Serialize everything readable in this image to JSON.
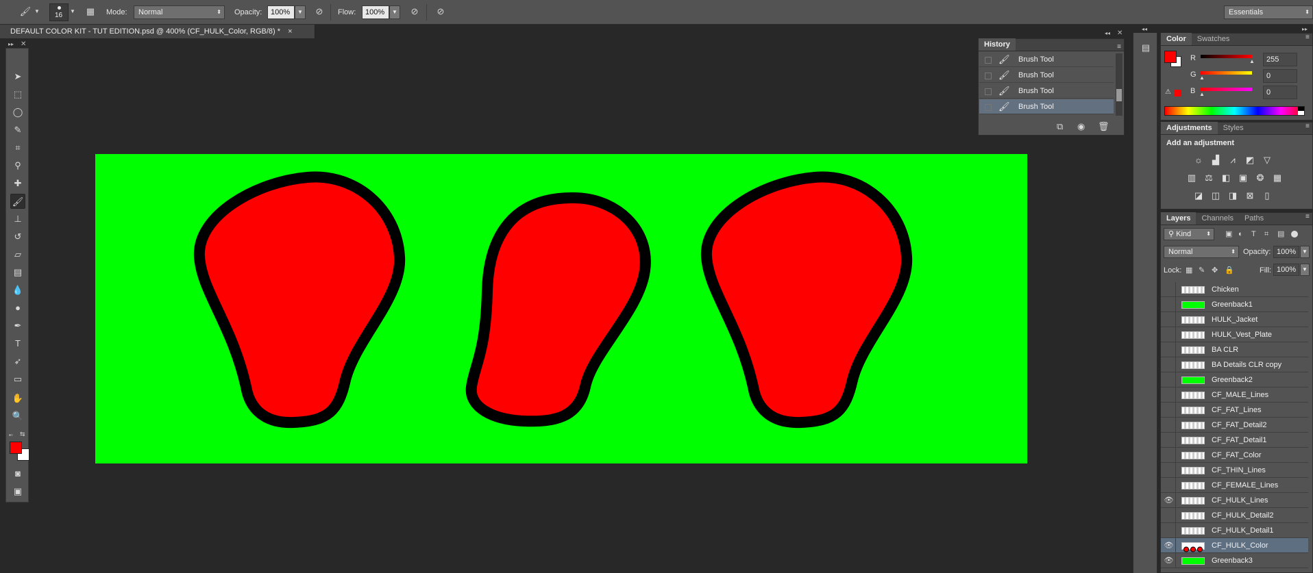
{
  "options_bar": {
    "brush_size": "16",
    "mode_label": "Mode:",
    "mode_value": "Normal",
    "opacity_label": "Opacity:",
    "opacity_value": "100%",
    "flow_label": "Flow:",
    "flow_value": "100%",
    "workspace": "Essentials"
  },
  "document": {
    "tab_title": "DEFAULT COLOR KIT - TUT EDITION.psd @ 400% (CF_HULK_Color, RGB/8) *",
    "close": "×",
    "canvas_bg": "#00ff00",
    "fill_color": "#ff0000",
    "stroke_color": "#000000"
  },
  "history": {
    "tab": "History",
    "items": [
      "Brush Tool",
      "Brush Tool",
      "Brush Tool",
      "Brush Tool"
    ],
    "current_index": 3
  },
  "color_panel": {
    "tabs": [
      "Color",
      "Swatches"
    ],
    "r_label": "R",
    "r_value": "255",
    "g_label": "G",
    "g_value": "0",
    "b_label": "B",
    "b_value": "0",
    "foreground": "#ff0000",
    "background": "#ffffff"
  },
  "adjustments": {
    "tabs": [
      "Adjustments",
      "Styles"
    ],
    "heading": "Add an adjustment"
  },
  "layers_panel": {
    "tabs": [
      "Layers",
      "Channels",
      "Paths"
    ],
    "kind_label": "Kind",
    "blend_mode": "Normal",
    "opacity_label": "Opacity:",
    "opacity_value": "100%",
    "lock_label": "Lock:",
    "fill_label": "Fill:",
    "fill_value": "100%",
    "layers": [
      {
        "name": "Chicken",
        "visible": false,
        "thumb": "check"
      },
      {
        "name": "Greenback1",
        "visible": false,
        "thumb": "green"
      },
      {
        "name": "HULK_Jacket",
        "visible": false,
        "thumb": "check"
      },
      {
        "name": "HULK_Vest_Plate",
        "visible": false,
        "thumb": "check"
      },
      {
        "name": "BA CLR",
        "visible": false,
        "thumb": "check"
      },
      {
        "name": "BA Details CLR copy",
        "visible": false,
        "thumb": "check"
      },
      {
        "name": "Greenback2",
        "visible": false,
        "thumb": "green"
      },
      {
        "name": "CF_MALE_Lines",
        "visible": false,
        "thumb": "check"
      },
      {
        "name": "CF_FAT_Lines",
        "visible": false,
        "thumb": "check"
      },
      {
        "name": "CF_FAT_Detail2",
        "visible": false,
        "thumb": "check"
      },
      {
        "name": "CF_FAT_Detail1",
        "visible": false,
        "thumb": "check"
      },
      {
        "name": "CF_FAT_Color",
        "visible": false,
        "thumb": "check"
      },
      {
        "name": "CF_THIN_Lines",
        "visible": false,
        "thumb": "check"
      },
      {
        "name": "CF_FEMALE_Lines",
        "visible": false,
        "thumb": "check"
      },
      {
        "name": "CF_HULK_Lines",
        "visible": true,
        "thumb": "check"
      },
      {
        "name": "CF_HULK_Detail2",
        "visible": false,
        "thumb": "check"
      },
      {
        "name": "CF_HULK_Detail1",
        "visible": false,
        "thumb": "check"
      },
      {
        "name": "CF_HULK_Color",
        "visible": true,
        "thumb": "red",
        "current": true
      },
      {
        "name": "Greenback3",
        "visible": true,
        "thumb": "green"
      }
    ]
  }
}
